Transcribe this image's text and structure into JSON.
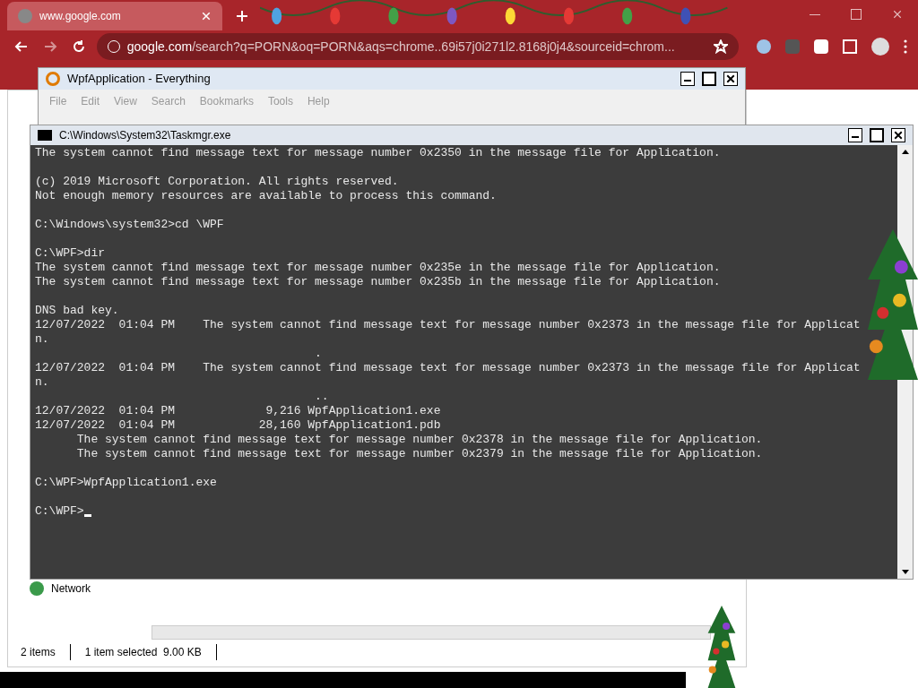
{
  "browser": {
    "tab": {
      "title": "www.google.com",
      "selected": true
    },
    "address": {
      "host": "google.com",
      "path": "/search?q=PORN&oq=PORN&aqs=chrome..69i57j0i271l2.8168j0j4&sourceid=chrom..."
    }
  },
  "everything": {
    "title": "WpfApplication - Everything",
    "menu": [
      "File",
      "Edit",
      "View",
      "Search",
      "Bookmarks",
      "Tools",
      "Help"
    ]
  },
  "explorer": {
    "nav": [
      {
        "label": "Network"
      }
    ],
    "status": [
      "2 items",
      "1 item selected  9.00 KB"
    ]
  },
  "console": {
    "title": "C:\\Windows\\System32\\Taskmgr.exe",
    "cursor": true,
    "blocks": [
      [
        "The system cannot find message text for message number 0x2350 in the message file for Application."
      ],
      [
        "(c) 2019 Microsoft Corporation. All rights reserved.",
        "Not enough memory resources are available to process this command."
      ],
      [
        "C:\\Windows\\system32>cd \\WPF"
      ],
      [
        "C:\\WPF>dir",
        "The system cannot find message text for message number 0x235e in the message file for Application.",
        "The system cannot find message text for message number 0x235b in the message file for Application."
      ],
      [
        "DNS bad key.",
        "12/07/2022  01:04 PM    The system cannot find message text for message number 0x2373 in the message file for Applicat",
        "n.",
        "                                        .",
        "12/07/2022  01:04 PM    The system cannot find message text for message number 0x2373 in the message file for Applicat",
        "n.",
        "                                        ..",
        "12/07/2022  01:04 PM             9,216 WpfApplication1.exe",
        "12/07/2022  01:04 PM            28,160 WpfApplication1.pdb",
        "      The system cannot find message text for message number 0x2378 in the message file for Application.",
        "      The system cannot find message text for message number 0x2379 in the message file for Application."
      ],
      [
        "C:\\WPF>WpfApplication1.exe"
      ],
      [
        "C:\\WPF>"
      ]
    ]
  }
}
